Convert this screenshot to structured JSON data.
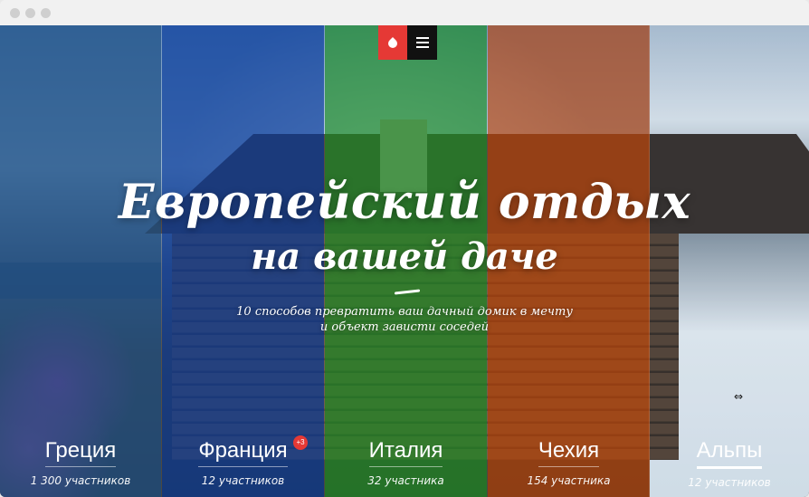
{
  "hero": {
    "title_line1": "Европейский отдых",
    "title_line2": "на вашей даче",
    "subtitle_line1": "10 способов превратить ваш дачный домик в мечту",
    "subtitle_line2": "и объект зависти соседей"
  },
  "countries": [
    {
      "name": "Греция",
      "count": "1 300 участников"
    },
    {
      "name": "Франция",
      "count": "12 участников",
      "badge": "+3"
    },
    {
      "name": "Италия",
      "count": "32 участника"
    },
    {
      "name": "Чехия",
      "count": "154 участника"
    },
    {
      "name": "Альпы",
      "count": "12 участников"
    }
  ],
  "colors": {
    "accent": "#e53935",
    "greece": "#22538a",
    "france": "#0e40a0",
    "italy": "#24912c",
    "czech": "#c44a0e"
  },
  "icons": {
    "logo": "logo-icon",
    "menu": "hamburger-menu-icon",
    "cursor": "resize-cursor-icon"
  }
}
